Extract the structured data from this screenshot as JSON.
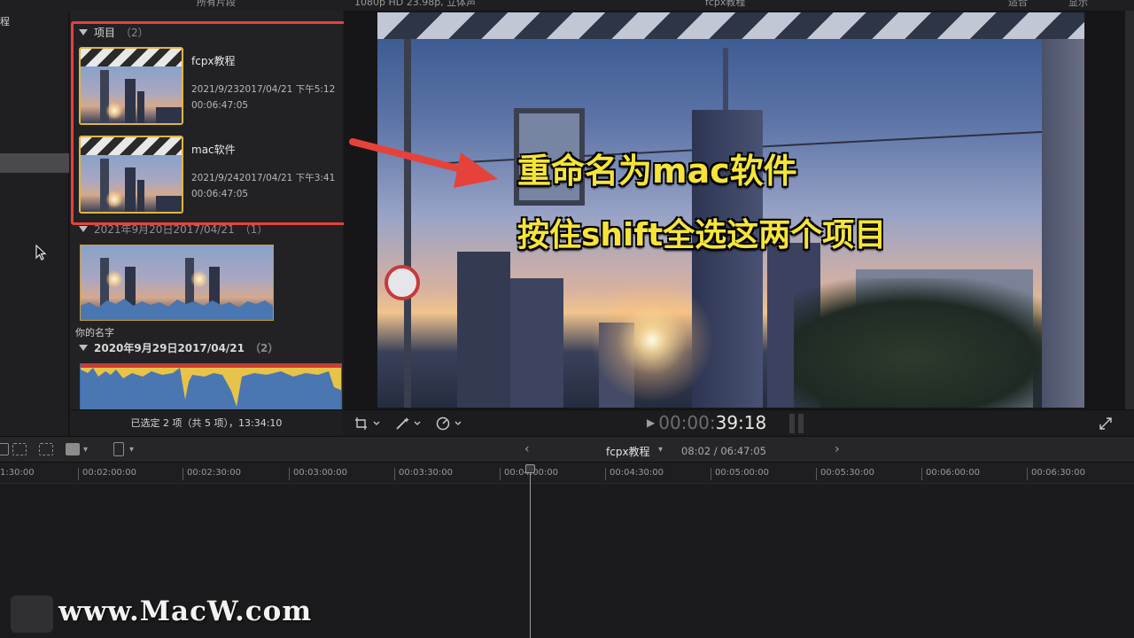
{
  "top_strip": {
    "left_text": "所有片段",
    "center_text": "1080p HD 23.98p, 立体声",
    "project_text": "fcpx教程",
    "right_a": "适合",
    "right_b": "显示"
  },
  "sidebar": {
    "cut_label": "程"
  },
  "browser": {
    "group_projects": {
      "title": "项目",
      "count": "（2）"
    },
    "projects": [
      {
        "name": "fcpx教程",
        "date": "2021/9/232017/04/21 下午5:12",
        "duration": "00:06:47:05"
      },
      {
        "name": "mac软件",
        "date": "2021/9/242017/04/21 下午3:41",
        "duration": "00:06:47:05"
      }
    ],
    "group_2021": {
      "title": "2021年9月20日2017/04/21",
      "count": "（1）"
    },
    "clip_name": "你的名字",
    "group_2020": {
      "title": "2020年9月29日2017/04/21",
      "count": "（2）"
    },
    "footer": "已选定 2 项（共 5 项），13:34:10"
  },
  "viewer": {
    "overlay_line1": "重命名为mac软件",
    "overlay_line2": "按住shift全选这两个项目",
    "timecode_dim": "00:00:",
    "timecode_main": "39:18"
  },
  "timeline": {
    "project_title": "fcpx教程",
    "time_display": "08:02 / 06:47:05",
    "ruler": [
      "1:30:00",
      "00:02:00:00",
      "00:02:30:00",
      "00:03:00:00",
      "00:03:30:00",
      "00:04:00:00",
      "00:04:30:00",
      "00:05:00:00",
      "00:05:30:00",
      "00:06:00:00",
      "00:06:30:00"
    ]
  },
  "watermark": "www.MacW.com",
  "colors": {
    "accent_red": "#e6423b",
    "overlay_yellow": "#f6e43a",
    "clip_border": "#e0b640"
  }
}
